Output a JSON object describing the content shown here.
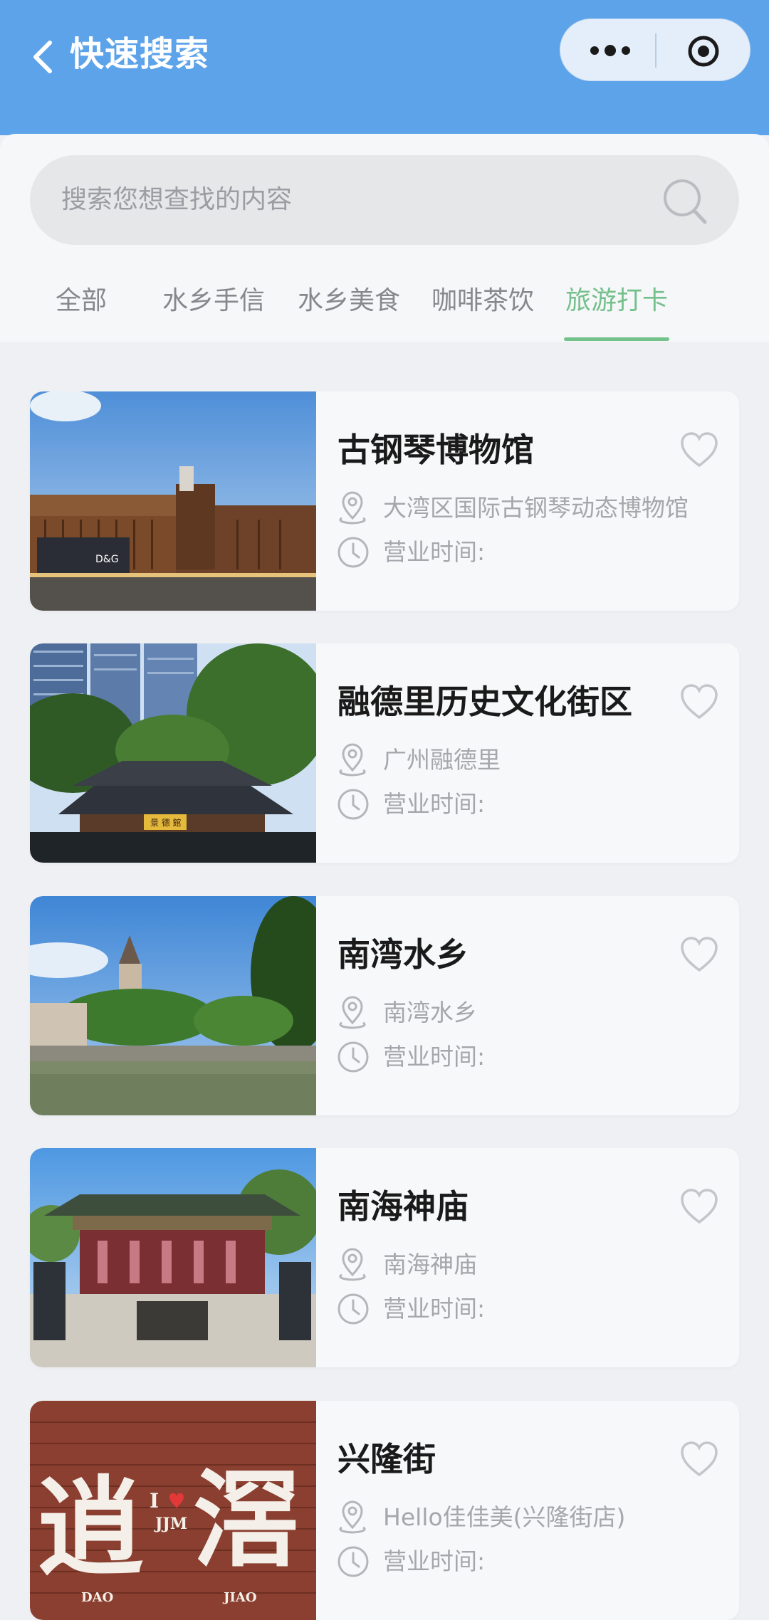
{
  "header": {
    "title": "快速搜索",
    "back_icon": "chevron-left-icon",
    "more_icon": "more-dots-icon",
    "close_icon": "target-circle-icon",
    "color": "#5da3ea"
  },
  "search": {
    "placeholder": "搜索您想查找的内容",
    "icon": "search-icon"
  },
  "tabs": [
    {
      "label": "全部",
      "active": false
    },
    {
      "label": "水乡手信",
      "active": false
    },
    {
      "label": "水乡美食",
      "active": false
    },
    {
      "label": "咖啡茶饮",
      "active": false
    },
    {
      "label": "旅游打卡",
      "active": true
    }
  ],
  "accent_color": "#72c28a",
  "places": [
    {
      "name": "古钢琴博物馆",
      "address": "大湾区国际古钢琴动态博物馆",
      "hours_label": "营业时间:"
    },
    {
      "name": "融德里历史文化街区",
      "address": "广州融德里",
      "hours_label": "营业时间:"
    },
    {
      "name": "南湾水乡",
      "address": "南湾水乡",
      "hours_label": "营业时间:"
    },
    {
      "name": "南海神庙",
      "address": "南海神庙",
      "hours_label": "营业时间:"
    },
    {
      "name": "兴隆街",
      "address": "Hello佳佳美(兴隆街店)",
      "hours_label": "营业时间:"
    }
  ],
  "thumbnail_text": {
    "piano_sign": "D&G",
    "plaque": "景 德 館",
    "brick_left": "逍",
    "brick_right": "滘",
    "brick_i": "I",
    "brick_jjm": "JJM",
    "brick_dao": "DAO",
    "brick_jiao": "JIAO"
  }
}
